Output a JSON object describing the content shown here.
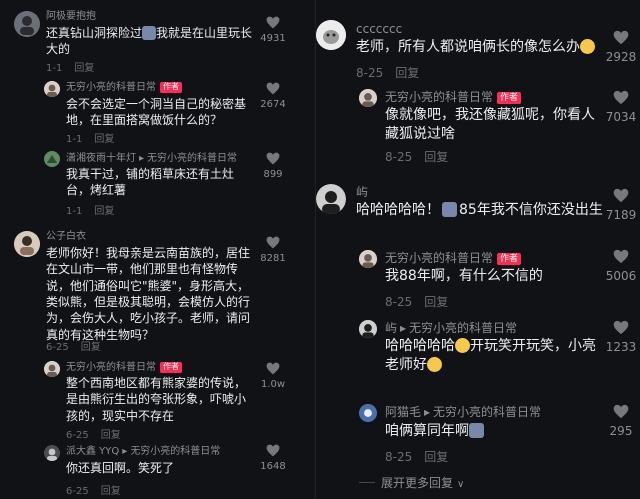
{
  "left": {
    "c1": {
      "user": "阿极要抱抱",
      "text_a": "还真钻山洞探险过",
      "text_b": "我就是在山里玩长大的",
      "date": "1-1",
      "reply": "回复",
      "likes": "4931"
    },
    "c2": {
      "user": "无穷小亮的科普日常",
      "badge": "作者",
      "text": "会不会选定一个洞当自己的秘密基地，在里面搭窝做饭什么的？",
      "date": "1-1",
      "reply": "回复",
      "likes": "2674"
    },
    "c3": {
      "user": "潇湘夜雨十年灯",
      "to": "无穷小亮的科普日常",
      "text": "我真干过，铺的稻草床还有土灶台，烤红薯",
      "date": "1-1",
      "reply": "回复",
      "likes": "899"
    },
    "c4": {
      "user": "公子白衣",
      "text": "老师你好！我母亲是云南苗族的，居住在文山市一带，他们那里也有怪物传说，他们通俗叫它\"熊婆\"，身形高大，类似熊，但是极其聪明，会模仿人的行为，会伤大人，吃小孩子。老师，请问真的有这种生物吗？",
      "date": "6-25",
      "reply": "回复",
      "likes": "8281"
    },
    "c5": {
      "user": "无穷小亮的科普日常",
      "badge": "作者",
      "text": "整个西南地区都有熊家婆的传说，是由熊衍生出的夸张形象，吓唬小孩的，现实中不存在",
      "date": "6-25",
      "reply": "回复",
      "likes": "1.0w"
    },
    "c6": {
      "user": "派大鑫 YYQ",
      "to": "无穷小亮的科普日常",
      "text": "你还真回啊。笑死了",
      "date": "6-25",
      "reply": "回复",
      "likes": "1648"
    }
  },
  "right": {
    "c1": {
      "user": "ccccccc",
      "text": "老师，所有人都说咱俩长的像怎么办",
      "date": "8-25",
      "reply": "回复",
      "likes": "2928"
    },
    "c2": {
      "user": "无穷小亮的科普日常",
      "badge": "作者",
      "text": "像就像吧，我还像藏狐呢，你看人藏狐说过啥",
      "date": "8-25",
      "reply": "回复",
      "likes": "7034"
    },
    "c3": {
      "user": "屿",
      "text_a": "哈哈哈哈哈！",
      "text_b": "85年我不信你还没出生",
      "likes": "7189"
    },
    "c4": {
      "user": "无穷小亮的科普日常",
      "badge": "作者",
      "text": "我88年啊，有什么不信的",
      "date": "8-25",
      "reply": "回复",
      "likes": "5006"
    },
    "c5": {
      "user": "屿",
      "to": "无穷小亮的科普日常",
      "text_a": "哈哈哈哈哈",
      "text_b": "开玩笑开玩笑，小亮老师好",
      "likes": "1233"
    },
    "c6": {
      "user": "阿猫毛",
      "to": "无穷小亮的科普日常",
      "text": "咱俩算同年啊",
      "date": "8-25",
      "reply": "回复",
      "likes": "295"
    },
    "more": "展开更多回复",
    "more_arrow": "∨"
  },
  "arrow": "▸",
  "colors": {
    "bg": "#111215",
    "author_badge": "#fe2c55",
    "username": "#8e8f95",
    "text": "#eeeef0"
  }
}
